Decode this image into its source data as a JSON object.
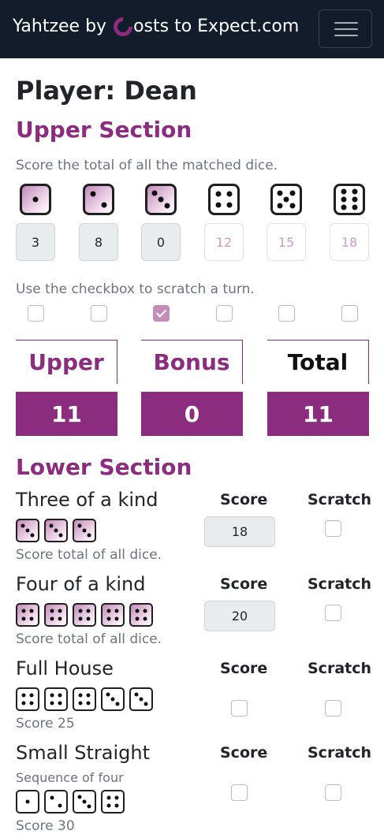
{
  "nav": {
    "brand_prefix": "Yahtzee by ",
    "brand_suffix": "osts to Expect.com"
  },
  "player": {
    "label": "Player: Dean"
  },
  "upper": {
    "title": "Upper Section",
    "instruction": "Score the total of all the matched dice.",
    "scratch_instruction": "Use the checkbox to scratch a turn.",
    "scores": [
      {
        "face": 1,
        "value": "3",
        "placeholder": "",
        "scratched": false
      },
      {
        "face": 2,
        "value": "8",
        "placeholder": "",
        "scratched": false
      },
      {
        "face": 3,
        "value": "0",
        "placeholder": "",
        "scratched": true
      },
      {
        "face": 4,
        "value": "",
        "placeholder": "12",
        "scratched": false
      },
      {
        "face": 5,
        "value": "",
        "placeholder": "15",
        "scratched": false
      },
      {
        "face": 6,
        "value": "",
        "placeholder": "18",
        "scratched": false
      }
    ]
  },
  "totals": {
    "upper_label": "Upper",
    "bonus_label": "Bonus",
    "total_label": "Total",
    "upper_value": "11",
    "bonus_value": "0",
    "total_value": "11"
  },
  "lower": {
    "title": "Lower Section",
    "score_header": "Score",
    "scratch_header": "Scratch",
    "categories": [
      {
        "name": "Three of a kind",
        "subtitle": "",
        "description": "Score total of all dice.",
        "dice": [
          3,
          3,
          3
        ],
        "tinted": true,
        "score_value": "18",
        "score_checkbox": false,
        "scratched": false
      },
      {
        "name": "Four of a kind",
        "subtitle": "",
        "description": "Score total of all dice.",
        "dice": [
          4,
          4,
          4,
          4,
          4
        ],
        "tinted": true,
        "score_value": "20",
        "score_checkbox": false,
        "scratched": false
      },
      {
        "name": "Full House",
        "subtitle": "",
        "description": "Score 25",
        "dice": [
          4,
          4,
          4,
          3,
          3
        ],
        "tinted": false,
        "score_value": "",
        "score_checkbox": true,
        "scratched": false
      },
      {
        "name": "Small Straight",
        "subtitle": "Sequence of four",
        "description": "Score 30",
        "dice": [
          1,
          2,
          3,
          4
        ],
        "tinted": false,
        "score_value": "",
        "score_checkbox": true,
        "scratched": false
      }
    ]
  },
  "colors": {
    "accent": "#8b2c7f",
    "navbar": "#131c2b",
    "muted_text": "#6c757d",
    "checkbox_checked": "#c48db9"
  },
  "icons": {
    "menu": "hamburger-menu-icon",
    "logo": "costs-to-expect-c-logo-icon",
    "die": "die-face-icon"
  }
}
